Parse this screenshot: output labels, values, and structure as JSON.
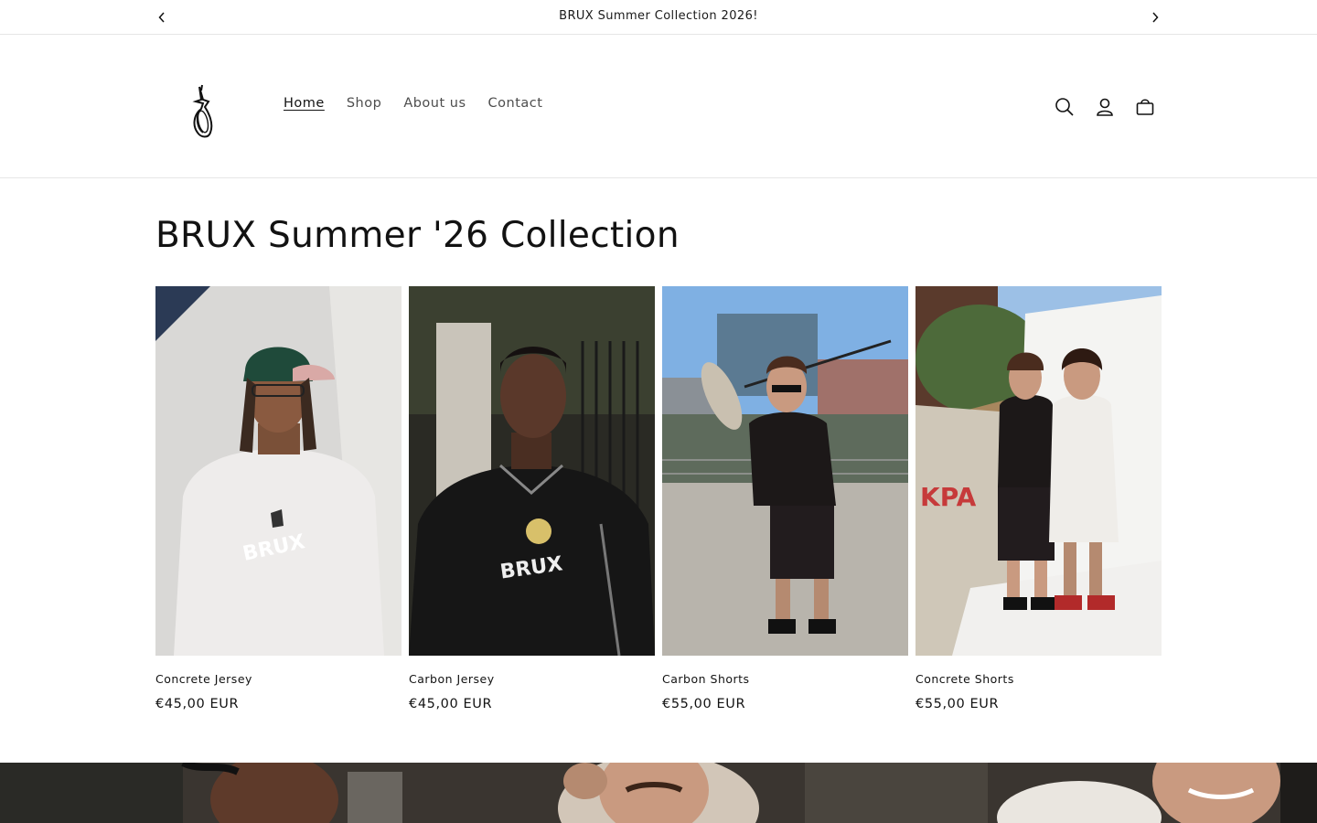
{
  "announcement": {
    "message": "BRUX Summer Collection 2026!",
    "prev_icon": "chevron-left-icon",
    "next_icon": "chevron-right-icon"
  },
  "header": {
    "logo": "brux-logo",
    "nav": [
      {
        "label": "Home",
        "active": true
      },
      {
        "label": "Shop",
        "active": false
      },
      {
        "label": "About us",
        "active": false
      },
      {
        "label": "Contact",
        "active": false
      }
    ],
    "icons": [
      "search-icon",
      "account-icon",
      "cart-icon"
    ]
  },
  "collection": {
    "title": "BRUX Summer '26 Collection",
    "products": [
      {
        "name": "Concrete Jersey",
        "price": "€45,00 EUR"
      },
      {
        "name": "Carbon Jersey",
        "price": "€45,00 EUR"
      },
      {
        "name": "Carbon Shorts",
        "price": "€55,00 EUR"
      },
      {
        "name": "Concrete Shorts",
        "price": "€55,00 EUR"
      }
    ]
  },
  "colors": {
    "text": "#121212",
    "nav_text": "#4d4d4d",
    "border": "#e6e6e6",
    "background": "#ffffff"
  }
}
